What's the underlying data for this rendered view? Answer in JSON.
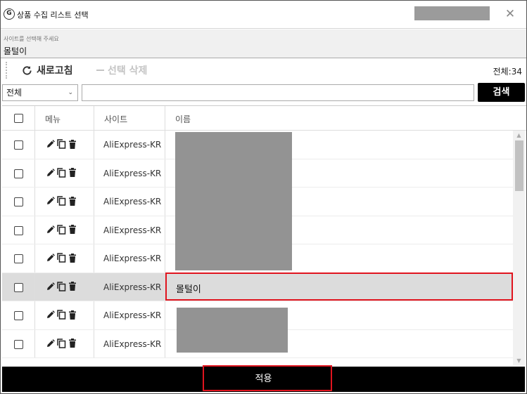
{
  "window": {
    "title": "상품 수집 리스트 선택",
    "close_glyph": "✕",
    "app_icon_glyph": "G"
  },
  "selection": {
    "label": "사이트를 선택해 주세요",
    "value": "몰털이"
  },
  "toolbar": {
    "refresh_label": "새로고침",
    "delete_label": "선택 삭제",
    "total_label": "전체:34"
  },
  "filter": {
    "selected": "전체",
    "search_placeholder": "",
    "search_value": "",
    "search_button": "검색"
  },
  "table": {
    "columns": [
      "메뉴",
      "사이트",
      "이름"
    ],
    "rows": [
      {
        "site": "AliExpress-KR",
        "name": ""
      },
      {
        "site": "AliExpress-KR",
        "name": ""
      },
      {
        "site": "AliExpress-KR",
        "name": ""
      },
      {
        "site": "AliExpress-KR",
        "name": ""
      },
      {
        "site": "AliExpress-KR",
        "name": ""
      },
      {
        "site": "AliExpress-KR",
        "name": "몰털이"
      },
      {
        "site": "AliExpress-KR",
        "name": ""
      },
      {
        "site": "AliExpress-KR",
        "name": ""
      }
    ],
    "selected_row": 5
  },
  "icons": {
    "edit": "pencil-icon",
    "copy": "copy-icon",
    "delete": "trash-icon",
    "refresh": "refresh-icon"
  },
  "colors": {
    "highlight": "#e0141e",
    "selected_row": "#dcdcdc",
    "button_bg": "#000000",
    "disabled_text": "#c4c4c4"
  },
  "footer": {
    "apply_label": "적용"
  }
}
